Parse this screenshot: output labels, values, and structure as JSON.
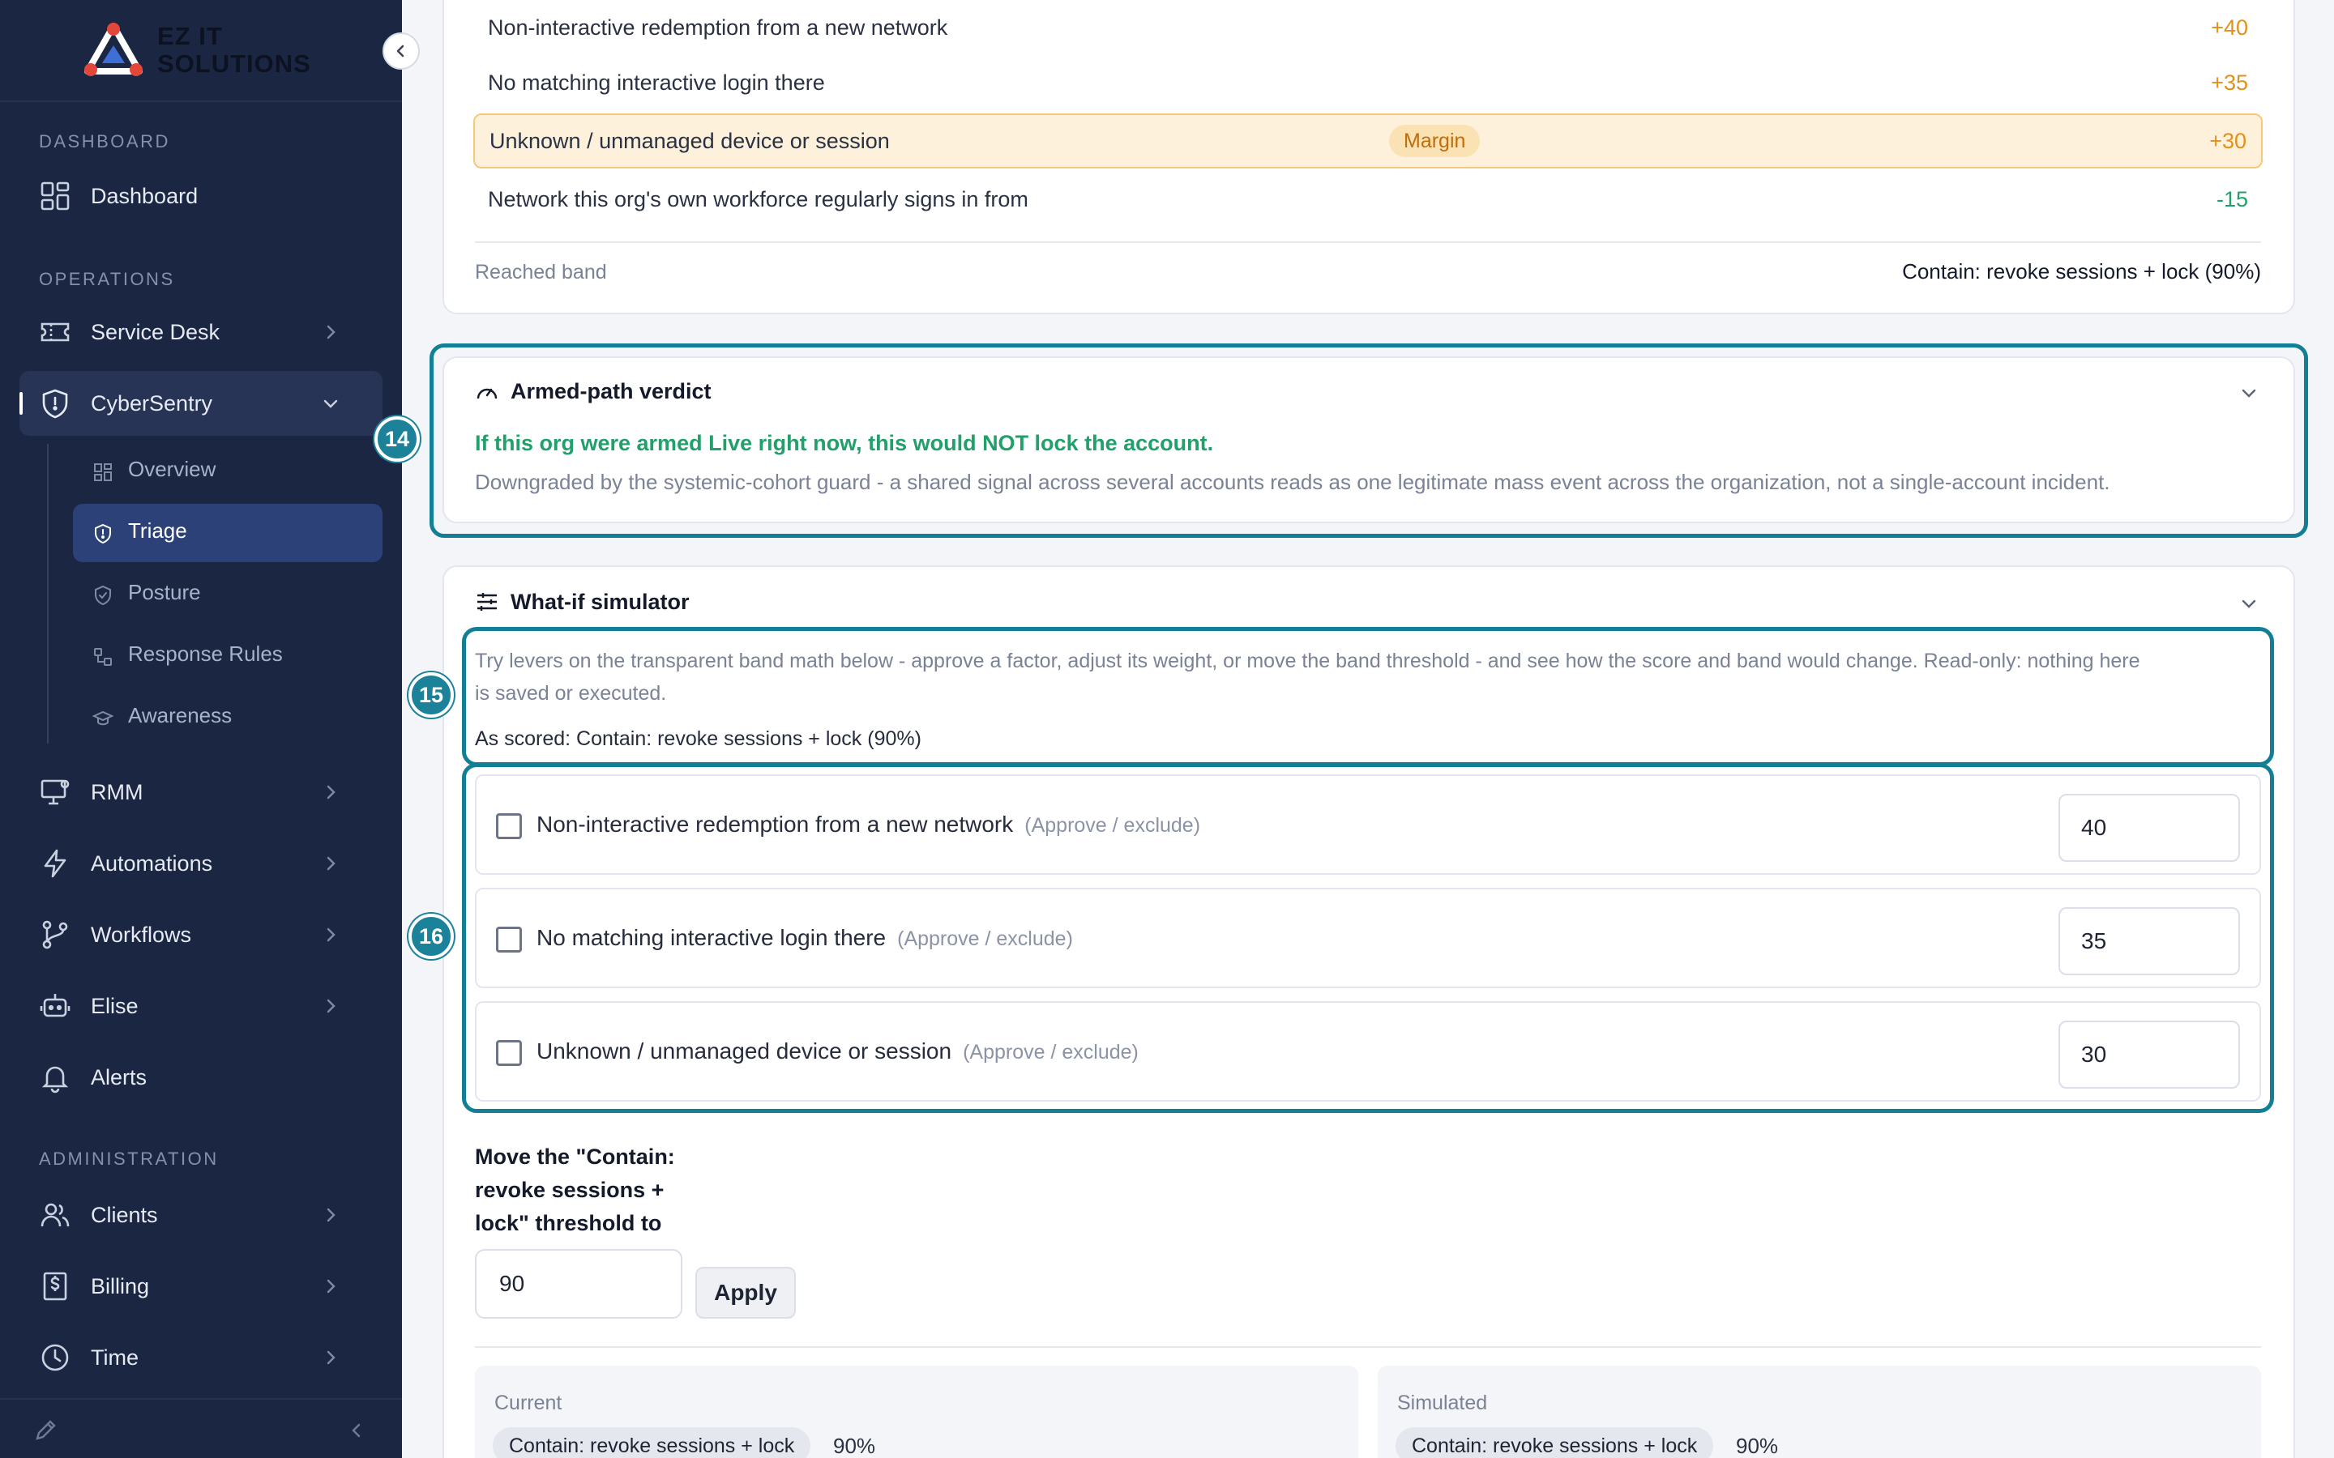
{
  "brand": {
    "name_line1": "EZ IT",
    "name_line2": "SOLUTIONS"
  },
  "sidebar": {
    "sections": {
      "dashboard": "DASHBOARD",
      "operations": "OPERATIONS",
      "administration": "ADMINISTRATION"
    },
    "items": {
      "dashboard": "Dashboard",
      "service_desk": "Service Desk",
      "cybersentry": "CyberSentry",
      "rmm": "RMM",
      "automations": "Automations",
      "workflows": "Workflows",
      "elise": "Elise",
      "alerts": "Alerts",
      "clients": "Clients",
      "billing": "Billing",
      "time": "Time"
    },
    "sub_items": {
      "overview": "Overview",
      "triage": "Triage",
      "posture": "Posture",
      "response_rules": "Response Rules",
      "awareness": "Awareness"
    }
  },
  "band_math": {
    "factors": [
      {
        "name": "Non-interactive redemption from a new network",
        "points": "+40"
      },
      {
        "name": "No matching interactive login there",
        "points": "+35"
      },
      {
        "name": "Unknown / unmanaged device or session",
        "points": "+30",
        "badge": "Margin"
      },
      {
        "name": "Network this org's own workforce regularly signs in from",
        "points": "-15"
      }
    ],
    "reached_label": "Reached band",
    "reached_value": "Contain: revoke sessions + lock (90%)"
  },
  "verdict": {
    "title": "Armed-path verdict",
    "headline": "If this org were armed Live right now, this would NOT lock the account.",
    "detail": "Downgraded by the systemic-cohort guard - a shared signal across several accounts reads as one legitimate mass event across the organization, not a single-account incident."
  },
  "simulator": {
    "title": "What-if simulator",
    "intro_line1": "Try levers on the transparent band math below - approve a factor, adjust its weight, or move the band threshold - and see how the score and band would change. Read-only: nothing here",
    "intro_line2": "is saved or executed.",
    "as_scored": "As scored: Contain: revoke sessions + lock (90%)",
    "levers": [
      {
        "name": "Non-interactive redemption from a new network",
        "hint": "(Approve / exclude)",
        "weight": "40"
      },
      {
        "name": "No matching interactive login there",
        "hint": "(Approve / exclude)",
        "weight": "35"
      },
      {
        "name": "Unknown / unmanaged device or session",
        "hint": "(Approve / exclude)",
        "weight": "30"
      }
    ],
    "threshold_label": "Move the \"Contain: revoke sessions + lock\" threshold to",
    "threshold_value": "90",
    "apply_label": "Apply",
    "current": {
      "caption": "Current",
      "band": "Contain: revoke sessions + lock",
      "pct": "90%"
    },
    "simulated": {
      "caption": "Simulated",
      "band": "Contain: revoke sessions + lock",
      "pct": "90%"
    }
  },
  "annotations": {
    "verdict": "14",
    "intro": "15",
    "levers": "16"
  },
  "colors": {
    "sidebar_bg": "#1b2642",
    "accent_teal": "#127f94",
    "positive_points": "#e0911a",
    "negative_points": "#22a06b",
    "verdict_green": "#22a06b"
  }
}
